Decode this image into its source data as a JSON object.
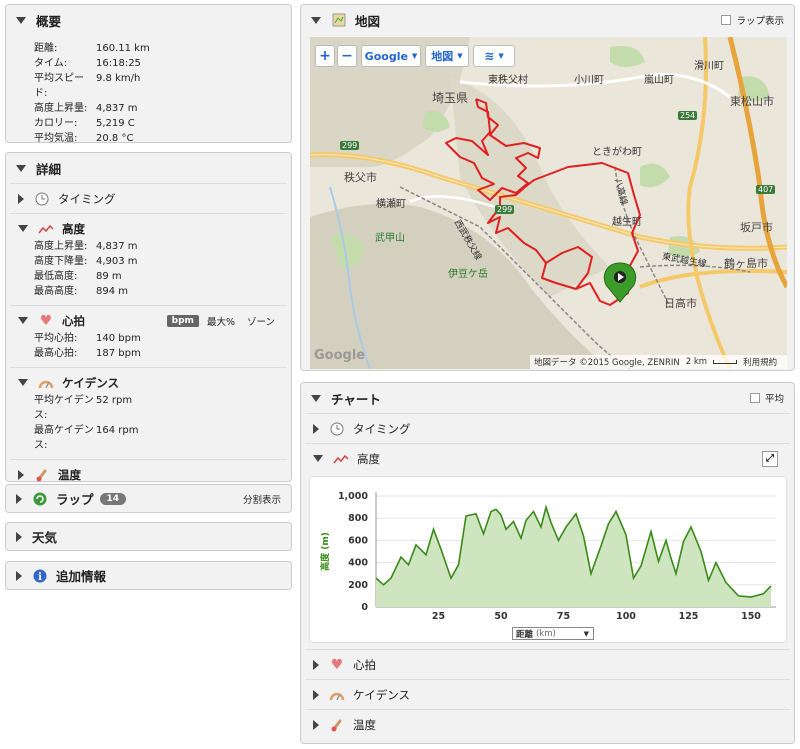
{
  "summary": {
    "title": "概要",
    "rows": [
      {
        "label": "距離:",
        "value": "160.11 km"
      },
      {
        "label": "タイム:",
        "value": "16:18:25"
      },
      {
        "label": "平均スピード:",
        "value": "9.8 km/h"
      },
      {
        "label": "高度上昇量:",
        "value": "4,837 m"
      },
      {
        "label": "カロリー:",
        "value": "5,219 C"
      },
      {
        "label": "平均気温:",
        "value": "20.8 °C"
      }
    ]
  },
  "details": {
    "title": "詳細",
    "timing_label": "タイミング",
    "elevation": {
      "label": "高度",
      "rows": [
        {
          "label": "高度上昇量:",
          "value": "4,837 m"
        },
        {
          "label": "高度下降量:",
          "value": "4,903 m"
        },
        {
          "label": "最低高度:",
          "value": "89 m"
        },
        {
          "label": "最高高度:",
          "value": "894 m"
        }
      ]
    },
    "heart": {
      "label": "心拍",
      "badge": "bpm",
      "opt1": "最大%",
      "opt2": "ゾーン",
      "rows": [
        {
          "label": "平均心拍:",
          "value": "140 bpm"
        },
        {
          "label": "最高心拍:",
          "value": "187 bpm"
        }
      ]
    },
    "cadence": {
      "label": "ケイデンス",
      "rows": [
        {
          "label": "平均ケイデンス:",
          "value": "52 rpm"
        },
        {
          "label": "最高ケイデンス:",
          "value": "164 rpm"
        }
      ]
    },
    "temp_label": "温度"
  },
  "laps": {
    "title": "ラップ",
    "count": "14",
    "split": "分割表示"
  },
  "weather": {
    "title": "天気"
  },
  "extra": {
    "title": "追加情報"
  },
  "map": {
    "title": "地図",
    "lap_toggle": "ラップ表示",
    "zoom_in": "+",
    "zoom_out": "−",
    "provider": "Google",
    "type": "地図",
    "attribution": "地図データ ©2015 Google, ZENRIN",
    "scale": "2 km",
    "terms": "利用規約",
    "logo": "Google",
    "places": {
      "saitama": "埼玉県",
      "higashichichibu": "東秩父村",
      "ogawa": "小川町",
      "ranzan": "嵐山町",
      "namegawa": "滑川町",
      "higashimatsuyama": "東松山市",
      "tokigawa": "ときがわ町",
      "chichibu": "秩父市",
      "yokoze": "横瀬町",
      "bukosan": "武甲山",
      "izugatake": "伊豆ケ岳",
      "ogose": "越生町",
      "sakado": "坂戸市",
      "tsurugashima": "鶴ヶ島市",
      "hidaka": "日高市",
      "seibu": "西武秩父線",
      "hachiko": "八高線",
      "tobu": "東武越生線",
      "road299a": "299",
      "road299b": "299",
      "road254": "254",
      "road407": "407"
    }
  },
  "chart": {
    "title": "チャート",
    "avg_label": "平均",
    "timing_label": "タイミング",
    "elevation_label": "高度",
    "heart_label": "心拍",
    "cadence_label": "ケイデンス",
    "temp_label": "温度",
    "x_selector": "距離",
    "x_unit": "(km)"
  },
  "chart_data": {
    "type": "area",
    "ylabel": "高度 (m)",
    "xlabel": "距離 (km)",
    "xlim": [
      0,
      160
    ],
    "ylim": [
      0,
      1000
    ],
    "xticks": [
      25,
      50,
      75,
      100,
      125,
      150
    ],
    "yticks": [
      "1,000",
      "800",
      "600",
      "400",
      "200",
      "0"
    ],
    "color": "#3a8a1a",
    "x": [
      0,
      3,
      6,
      10,
      13,
      16,
      20,
      23,
      26,
      30,
      33,
      36,
      40,
      43,
      46,
      48,
      50,
      52,
      55,
      58,
      60,
      63,
      66,
      68,
      70,
      73,
      76,
      80,
      83,
      86,
      90,
      93,
      96,
      100,
      103,
      106,
      110,
      113,
      116,
      118,
      120,
      123,
      126,
      130,
      133,
      136,
      140,
      145,
      150,
      155,
      158
    ],
    "values": [
      260,
      200,
      260,
      450,
      380,
      560,
      470,
      700,
      520,
      260,
      380,
      820,
      840,
      660,
      860,
      880,
      830,
      700,
      770,
      620,
      780,
      860,
      720,
      900,
      760,
      600,
      720,
      840,
      640,
      300,
      550,
      750,
      860,
      650,
      260,
      370,
      680,
      410,
      600,
      440,
      300,
      590,
      720,
      500,
      240,
      400,
      220,
      100,
      90,
      120,
      190
    ]
  }
}
